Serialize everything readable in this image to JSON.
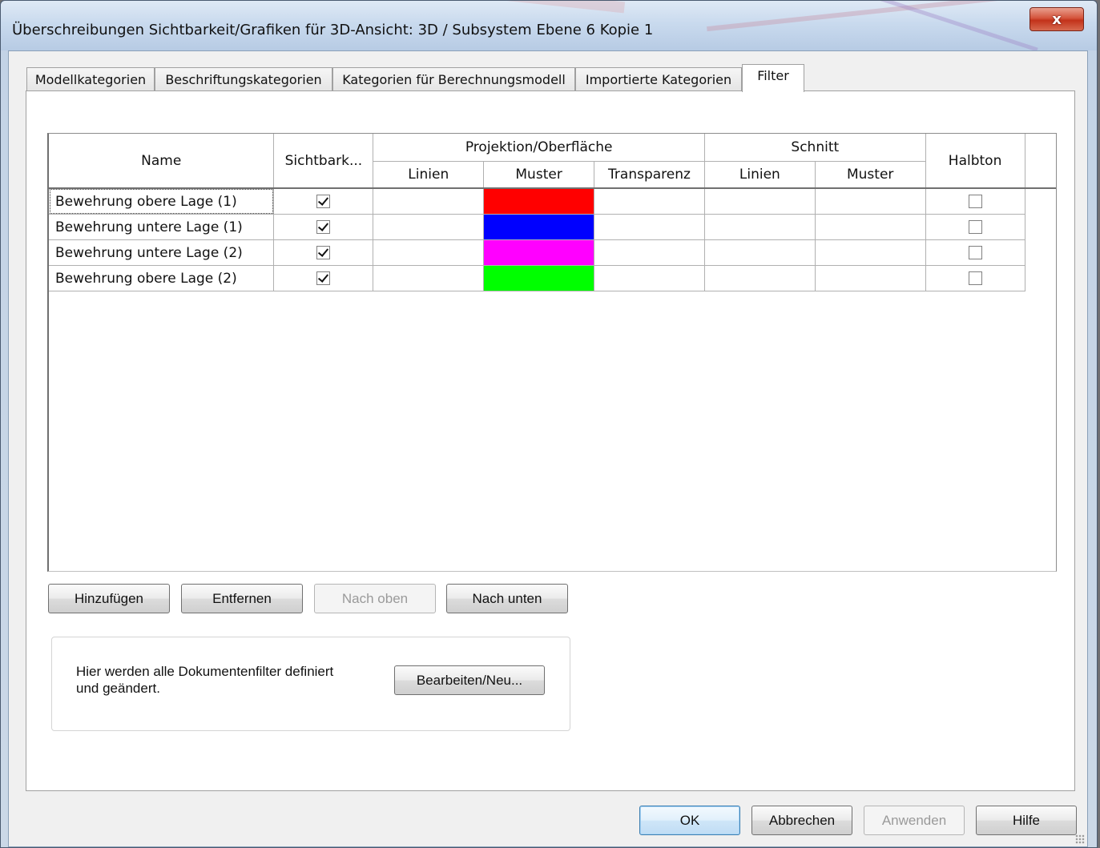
{
  "window": {
    "title": "Überschreibungen Sichtbarkeit/Grafiken für 3D-Ansicht: 3D / Subsystem Ebene 6 Kopie 1",
    "close_glyph": "x"
  },
  "tabs": [
    {
      "label": "Modellkategorien",
      "active": false
    },
    {
      "label": "Beschriftungskategorien",
      "active": false
    },
    {
      "label": "Kategorien für Berechnungsmodell",
      "active": false
    },
    {
      "label": "Importierte Kategorien",
      "active": false
    },
    {
      "label": "Filter",
      "active": true
    }
  ],
  "grid": {
    "headers": {
      "name": "Name",
      "visibility": "Sichtbark...",
      "projection_group": "Projektion/Oberfläche",
      "proj_lines": "Linien",
      "proj_pattern": "Muster",
      "proj_transparency": "Transparenz",
      "cut_group": "Schnitt",
      "cut_lines": "Linien",
      "cut_pattern": "Muster",
      "halftone": "Halbton"
    },
    "rows": [
      {
        "name": "Bewehrung obere Lage (1)",
        "visible": true,
        "pattern_color": "#ff0000",
        "halftone": false
      },
      {
        "name": "Bewehrung untere Lage (1)",
        "visible": true,
        "pattern_color": "#0000ff",
        "halftone": false
      },
      {
        "name": "Bewehrung untere Lage (2)",
        "visible": true,
        "pattern_color": "#ff00ff",
        "halftone": false
      },
      {
        "name": "Bewehrung obere Lage (2)",
        "visible": true,
        "pattern_color": "#00ff00",
        "halftone": false
      }
    ]
  },
  "actions": {
    "add": "Hinzufügen",
    "remove": "Entfernen",
    "move_up": "Nach oben",
    "move_down": "Nach unten"
  },
  "info": {
    "text": "Hier werden alle Dokumentenfilter definiert und geändert.",
    "edit_button": "Bearbeiten/Neu..."
  },
  "footer": {
    "ok": "OK",
    "cancel": "Abbrechen",
    "apply": "Anwenden",
    "help": "Hilfe"
  }
}
